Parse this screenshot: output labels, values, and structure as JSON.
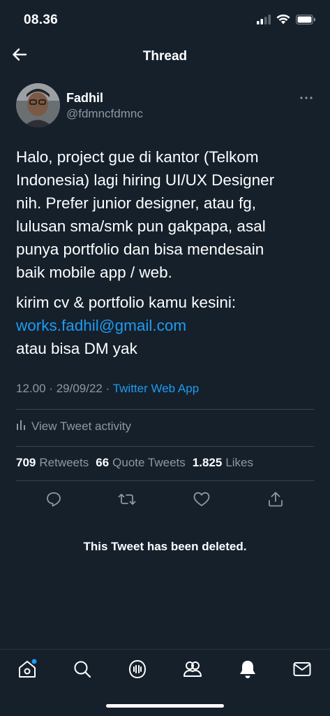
{
  "status_bar": {
    "time": "08.36",
    "icons": [
      "cellular-signal-icon",
      "wifi-icon",
      "battery-icon"
    ]
  },
  "header": {
    "title": "Thread",
    "back_icon": "arrow-left-icon"
  },
  "tweet": {
    "author": {
      "name": "Fadhil",
      "handle": "@fdmncfdmnc"
    },
    "body_lines": [
      "Halo, project gue di kantor (Telkom",
      "Indonesia) lagi hiring UI/UX Designer",
      "nih. Prefer junior designer, atau fg,",
      "lulusan sma/smk pun gakpapa, asal",
      "punya portfolio dan bisa mendesain",
      "baik mobile app / web."
    ],
    "body_line_cv": "kirim cv & portfolio kamu kesini:",
    "email": "works.fadhil@gmail.com",
    "body_line_dm": "atau bisa DM yak",
    "time": "12.00",
    "date": "29/09/22",
    "separator": "·",
    "source": "Twitter Web App",
    "activity_label": "View Tweet activity",
    "stats": {
      "retweets_count": "709",
      "retweets_label": "Retweets",
      "quotes_count": "66",
      "quotes_label": "Quote Tweets",
      "likes_count": "1.825",
      "likes_label": "Likes"
    },
    "actions": [
      "reply-icon",
      "retweet-icon",
      "like-icon",
      "share-icon"
    ]
  },
  "deleted_notice": "This Tweet has been deleted.",
  "tab_bar": {
    "tabs": [
      "home-icon",
      "search-icon",
      "spaces-icon",
      "communities-icon",
      "notifications-icon",
      "messages-icon"
    ],
    "home_badge_color": "#1d9bf0"
  },
  "colors": {
    "background": "#15202b",
    "accent": "#1d9bf0",
    "muted_text": "#8b98a5",
    "divider": "#38444d"
  }
}
